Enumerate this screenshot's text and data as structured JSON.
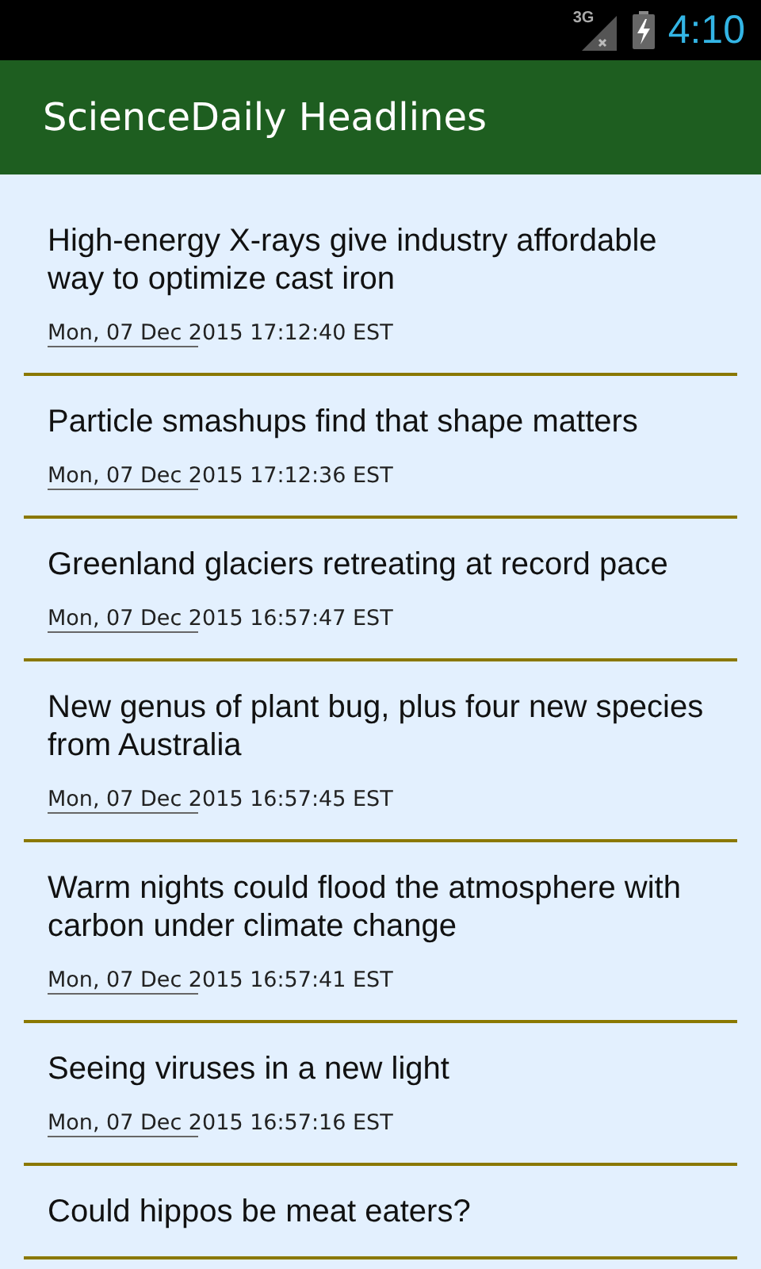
{
  "status_bar": {
    "network": "3G",
    "time": "4:10"
  },
  "app_bar": {
    "title": "ScienceDaily Headlines"
  },
  "headlines": [
    {
      "title": "High-energy X-rays give industry affordable way to optimize cast iron",
      "date": "Mon, 07 Dec 2015 17:12:40 EST"
    },
    {
      "title": "Particle smashups find that shape matters",
      "date": "Mon, 07 Dec 2015 17:12:36 EST"
    },
    {
      "title": "Greenland glaciers retreating at record pace",
      "date": "Mon, 07 Dec 2015 16:57:47 EST"
    },
    {
      "title": "New genus of plant bug, plus four new species from Australia",
      "date": "Mon, 07 Dec 2015 16:57:45 EST"
    },
    {
      "title": "Warm nights could flood the atmosphere with carbon under climate change",
      "date": "Mon, 07 Dec 2015 16:57:41 EST"
    },
    {
      "title": "Seeing viruses in a new light",
      "date": "Mon, 07 Dec 2015 16:57:16 EST"
    },
    {
      "title": "Could hippos be meat eaters?"
    }
  ]
}
